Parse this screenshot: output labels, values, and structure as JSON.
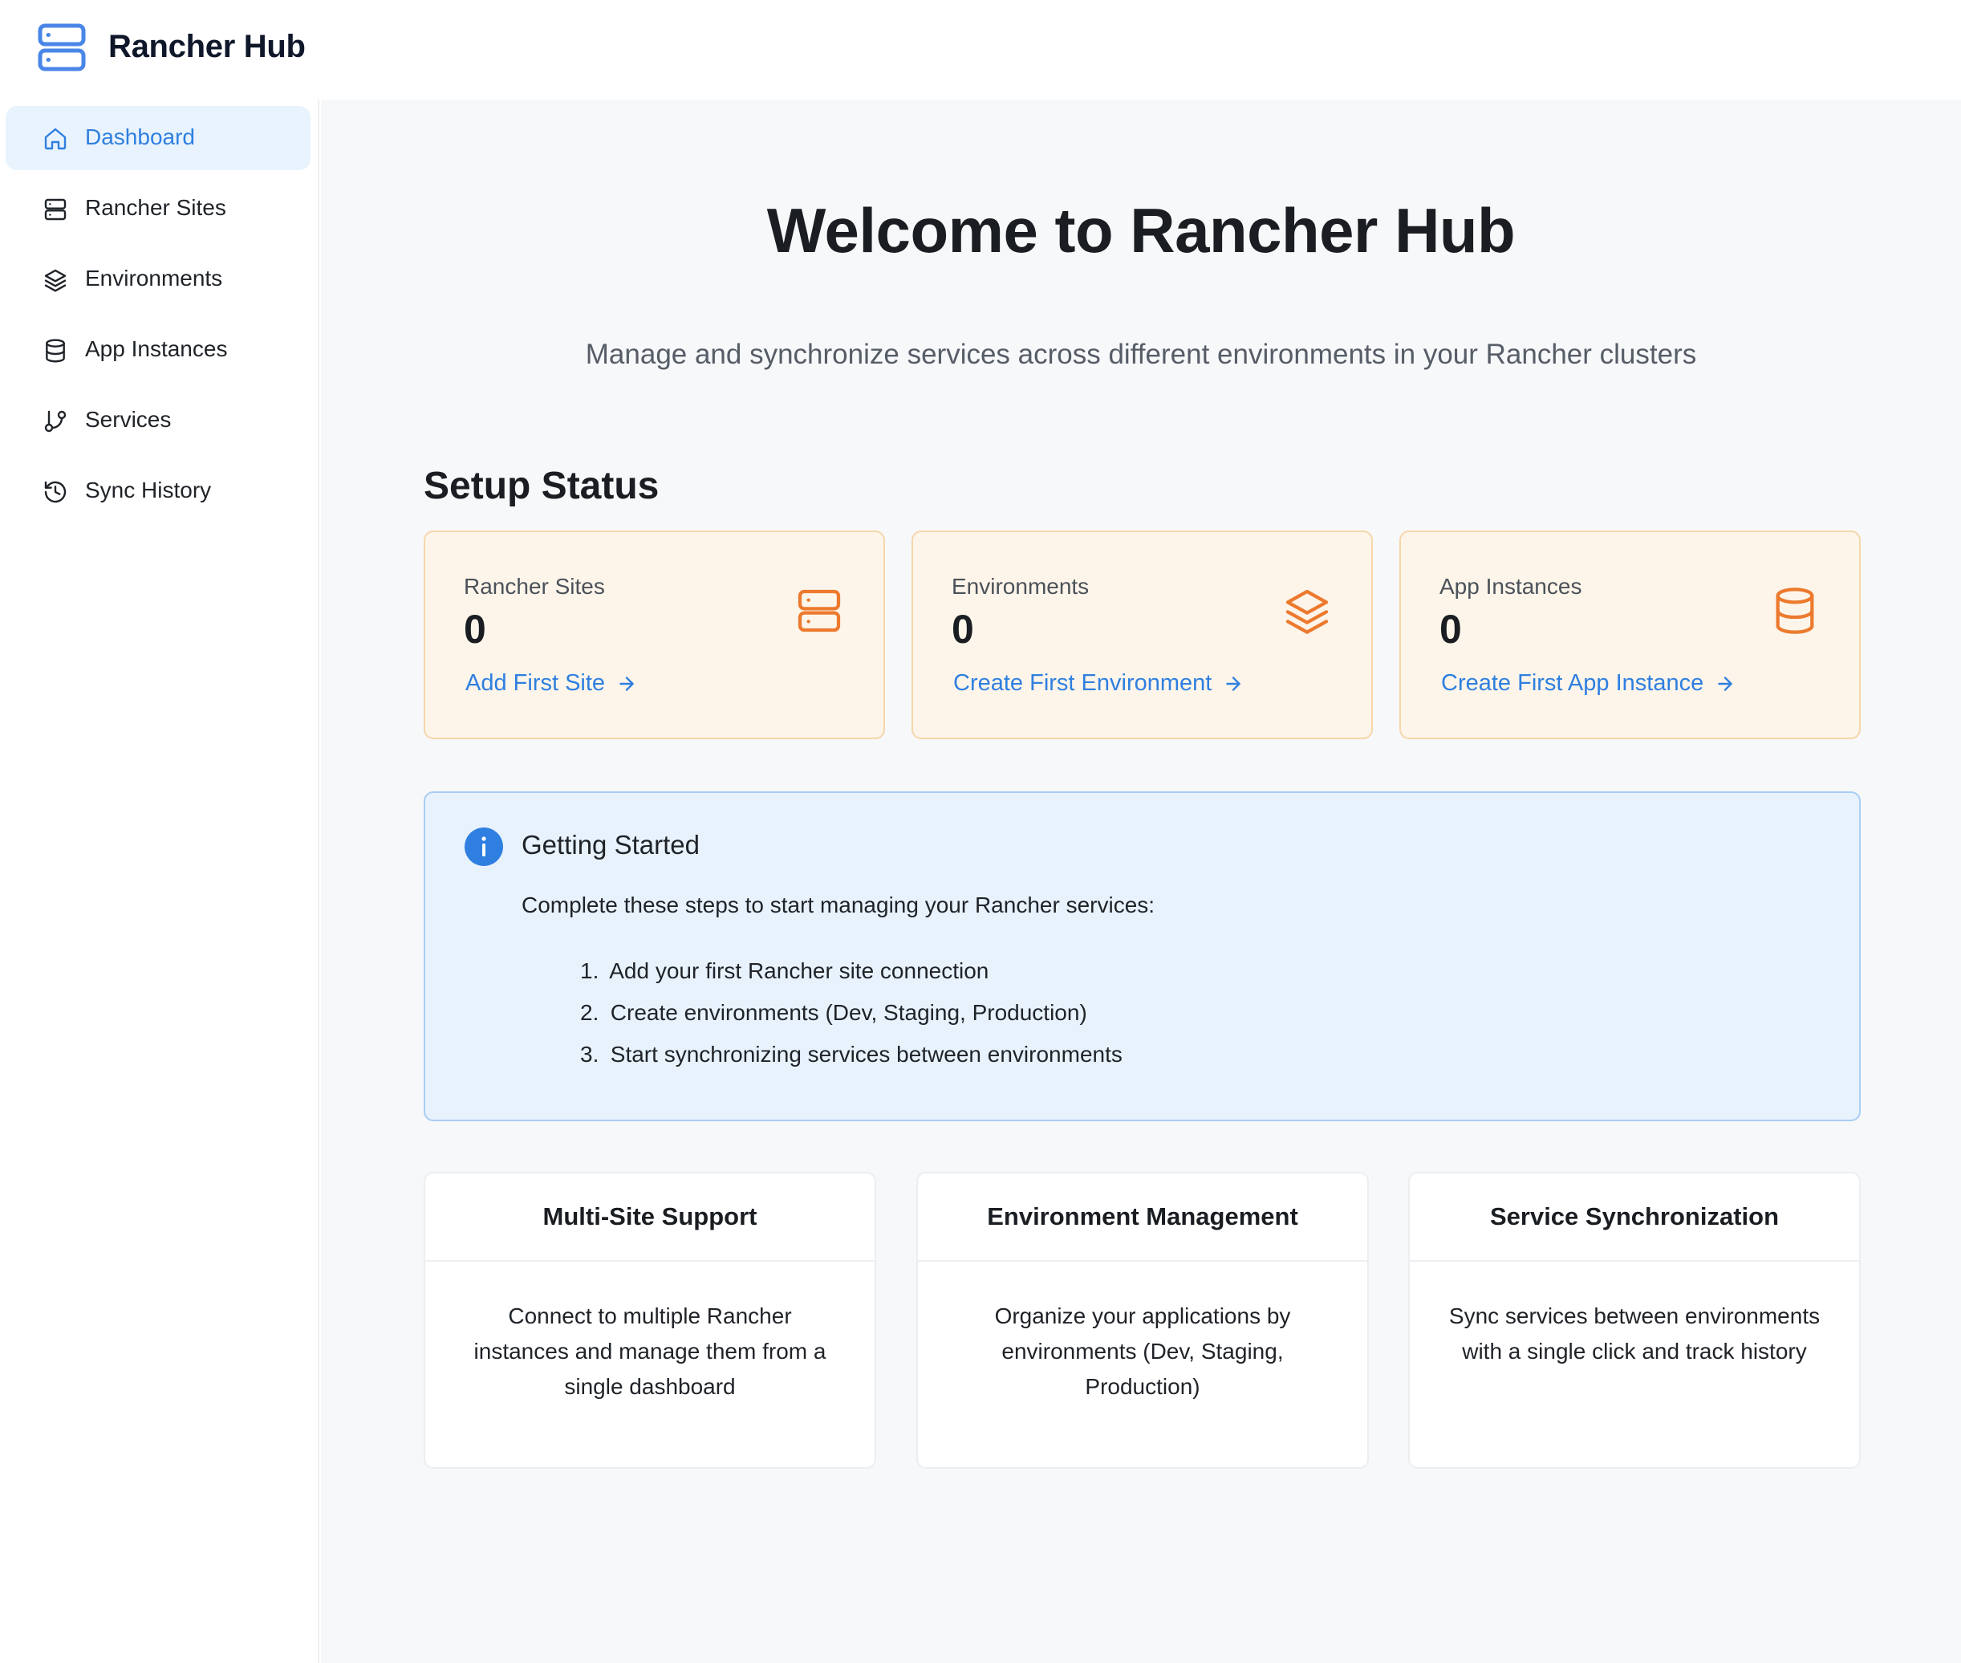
{
  "app": {
    "title": "Rancher Hub"
  },
  "sidebar": {
    "items": [
      {
        "label": "Dashboard",
        "icon": "home-icon",
        "active": true
      },
      {
        "label": "Rancher Sites",
        "icon": "server-icon"
      },
      {
        "label": "Environments",
        "icon": "layers-icon"
      },
      {
        "label": "App Instances",
        "icon": "database-icon"
      },
      {
        "label": "Services",
        "icon": "git-branch-icon"
      },
      {
        "label": "Sync History",
        "icon": "history-icon"
      }
    ]
  },
  "main": {
    "title": "Welcome to Rancher Hub",
    "subtitle": "Manage and synchronize services across different environments in your Rancher clusters",
    "setup_status": {
      "title": "Setup Status",
      "cards": [
        {
          "label": "Rancher Sites",
          "count": "0",
          "link": "Add First Site",
          "icon": "server-icon"
        },
        {
          "label": "Environments",
          "count": "0",
          "link": "Create First Environment",
          "icon": "layers-icon"
        },
        {
          "label": "App Instances",
          "count": "0",
          "link": "Create First App Instance",
          "icon": "database-icon"
        }
      ]
    },
    "getting_started": {
      "title": "Getting Started",
      "intro": "Complete these steps to start managing your Rancher services:",
      "steps": [
        "Add your first Rancher site connection",
        "Create environments (Dev, Staging, Production)",
        "Start synchronizing services between environments"
      ]
    },
    "features": [
      {
        "title": "Multi-Site Support",
        "body": "Connect to multiple Rancher instances and manage them from a single dashboard"
      },
      {
        "title": "Environment Management",
        "body": "Organize your applications by environments (Dev, Staging, Production)"
      },
      {
        "title": "Service Synchronization",
        "body": "Sync services between environments with a single click and track history"
      }
    ]
  },
  "colors": {
    "accent": "#2f7fe0",
    "status_card_bg": "#fdf5ea",
    "status_icon": "#ec7a2e",
    "info_bg": "#e8f2fd"
  }
}
